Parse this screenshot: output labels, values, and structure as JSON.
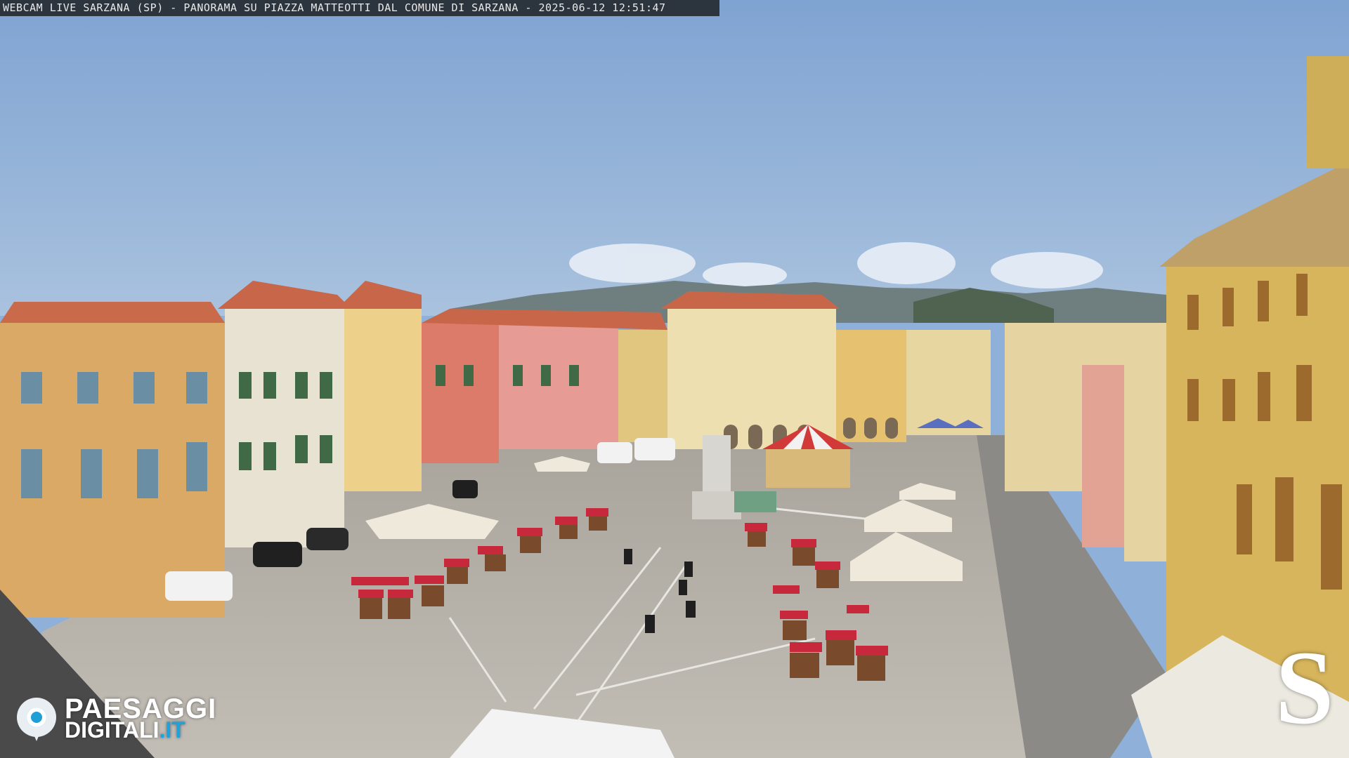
{
  "overlay": {
    "caption": "WEBCAM LIVE SARZANA (SP) - PANORAMA SU PIAZZA MATTEOTTI DAL COMUNE DI SARZANA - 2025-06-12  12:51:47"
  },
  "logo": {
    "line1": "PAESAGGI",
    "line2": "DIGITALI",
    "line2_suffix": ".IT",
    "accent_color": "#1fa2dc",
    "icon": "camera-lens-pin-icon"
  },
  "corner_mark": {
    "letter": "S"
  },
  "colors": {
    "sky": "#8fb0d8",
    "pavement": "#b9b5ad",
    "stall_canopy": "#c8283c"
  }
}
